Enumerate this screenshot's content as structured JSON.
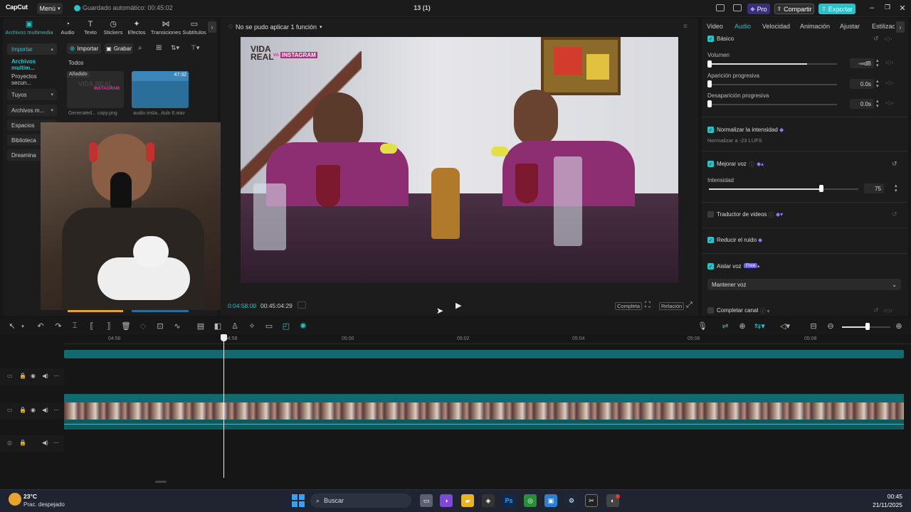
{
  "titlebar": {
    "logo": "CapCut",
    "menu_label": "Menú",
    "autosave": "Guardado automático: 00:45:02",
    "project_title": "13 (1)",
    "pro_label": "Pro",
    "share_label": "Compartir",
    "export_label": "Exportar"
  },
  "media_tabs": [
    {
      "label": "Archivos multimedia",
      "icon": "media-icon"
    },
    {
      "label": "Audio",
      "icon": "audio-icon"
    },
    {
      "label": "Texto",
      "icon": "text-icon"
    },
    {
      "label": "Stickers",
      "icon": "sticker-icon"
    },
    {
      "label": "Efectos",
      "icon": "effects-icon"
    },
    {
      "label": "Transiciones",
      "icon": "transitions-icon"
    },
    {
      "label": "Subtítulos",
      "icon": "subtitles-icon"
    }
  ],
  "sidebar": {
    "items": [
      {
        "label": "Importar"
      },
      {
        "label": "Archivos multim..."
      },
      {
        "label": "Proyectos secun..."
      },
      {
        "label": "Tuyos"
      },
      {
        "label": "Archivos m..."
      },
      {
        "label": "Espacios"
      },
      {
        "label": "Biblioteca"
      },
      {
        "label": "Dreamina"
      }
    ]
  },
  "media_toolbar": {
    "import_label": "Importar",
    "record_label": "Grabar",
    "filter_label": "Todos"
  },
  "media_items": [
    {
      "badge": "Añadido",
      "thumb_text": "VIDA REAL",
      "thumb_sub": "INSTAGRAM",
      "name": "Generated... copy.png"
    },
    {
      "badge": "",
      "duration": "47:32",
      "name": "audio insta...itulo 6.wav"
    }
  ],
  "preview": {
    "status": "No se pudo aplicar 1 función",
    "current_time": "0:04:58:00",
    "total_time": "00:45:04:29",
    "full_label": "Completa",
    "ratio_label": "Relación",
    "overlay_title_1": "VIDA",
    "overlay_title_2": "REAL",
    "overlay_vs": "vs",
    "overlay_brand": "INSTAGRAM"
  },
  "inspector": {
    "tabs": [
      "Video",
      "Audio",
      "Velocidad",
      "Animación",
      "Ajustar",
      "Estilizac"
    ],
    "basic_label": "Básico",
    "volume_label": "Volumen",
    "volume_value": "-∞dB",
    "volume_level": 0.0,
    "fade_in_label": "Aparición progresiva",
    "fade_in_value": "0.0s",
    "fade_out_label": "Desaparición progresiva",
    "fade_out_value": "0.0s",
    "normalize_label": "Normalizar la intensidad",
    "normalize_sub": "Normalizar a -23 LUFS",
    "enhance_label": "Mejorar voz",
    "intensity_label": "Intensidad",
    "intensity_value": "75",
    "intensity_level": 0.75,
    "translate_label": "Traductor de videos",
    "noise_label": "Reducir el ruido",
    "isolate_label": "Aislar voz",
    "isolate_badge": "Free",
    "keep_voice_label": "Mantener voz",
    "fill_channel_label": "Completar canal"
  },
  "timeline": {
    "ruler": [
      "04:56",
      "04:58",
      "05:00",
      "05:02",
      "05:04",
      "05:06",
      "05:08"
    ]
  },
  "taskbar": {
    "temp": "23°C",
    "weather": "Prac. despejado",
    "search_label": "Buscar",
    "time": "00:45",
    "date": "21/11/2025"
  },
  "colors": {
    "accent": "#25c4c9",
    "pro": "#6d5cff",
    "share_bg": "#2e2e2e",
    "export_bg": "#25c4c9"
  }
}
